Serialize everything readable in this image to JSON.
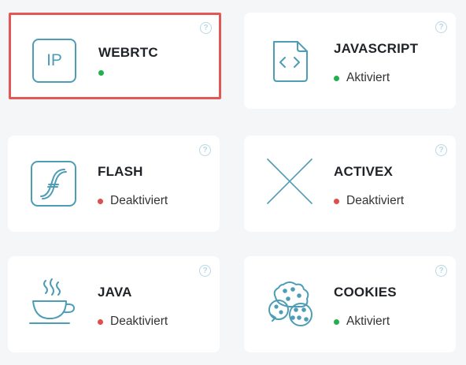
{
  "features": [
    {
      "id": "webrtc",
      "title": "WEBRTC",
      "icon": "ip-icon",
      "icon_text": "IP",
      "status": "",
      "status_color": "#21b04b"
    },
    {
      "id": "javascript",
      "title": "JAVASCRIPT",
      "icon": "code-file-icon",
      "status": "Aktiviert",
      "status_color": "#21b04b"
    },
    {
      "id": "flash",
      "title": "FLASH",
      "icon": "flash-icon",
      "status": "Deaktiviert",
      "status_color": "#e04f4f"
    },
    {
      "id": "activex",
      "title": "ACTIVEX",
      "icon": "activex-cross-icon",
      "status": "Deaktiviert",
      "status_color": "#e04f4f"
    },
    {
      "id": "java",
      "title": "JAVA",
      "icon": "coffee-cup-icon",
      "status": "Deaktiviert",
      "status_color": "#e04f4f"
    },
    {
      "id": "cookies",
      "title": "COOKIES",
      "icon": "cookies-icon",
      "status": "Aktiviert",
      "status_color": "#21b04b"
    }
  ],
  "help_glyph": "?",
  "colors": {
    "accent": "#4e9db6",
    "enabled": "#21b04b",
    "disabled": "#e04f4f",
    "selected_border": "#e35757"
  }
}
